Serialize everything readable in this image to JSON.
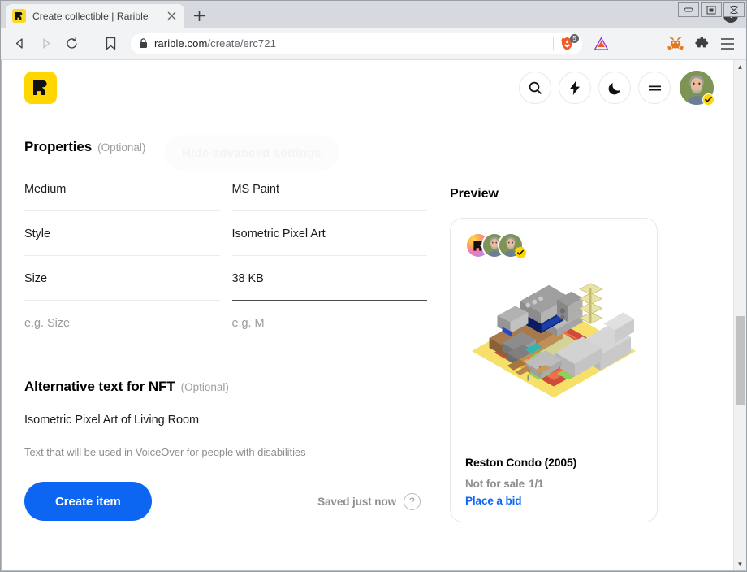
{
  "browser": {
    "window_controls": {
      "minimize": "minimize-icon",
      "maximize": "maximize-icon",
      "close": "close-icon"
    },
    "tab": {
      "title": "Create collectible | Rarible",
      "favicon": "rarible-logo-icon",
      "close_label": "×"
    },
    "new_tab_label": "+",
    "tab_search_icon": "chevron-down-icon",
    "toolbar": {
      "back_icon": "back-arrow-icon",
      "forward_icon": "forward-arrow-icon",
      "reload_icon": "reload-icon",
      "bookmark_icon": "bookmark-icon",
      "lock_icon": "lock-icon",
      "url_domain": "rarible.com",
      "url_path": "/create/erc721",
      "brave_shield_icon": "brave-lion-icon",
      "brave_badge_count": "5",
      "bat_icon": "bat-triangle-icon",
      "metamask_icon": "metamask-fox-icon",
      "extensions_icon": "puzzle-piece-icon",
      "menu_icon": "hamburger-menu-icon"
    }
  },
  "page": {
    "logo": "rarible-logo-icon",
    "ghost_button_label": "Hide advanced settings",
    "header_buttons": [
      {
        "name": "search-button",
        "icon": "search-icon"
      },
      {
        "name": "activity-button",
        "icon": "lightning-bolt-icon"
      },
      {
        "name": "dark-mode-button",
        "icon": "moon-icon"
      },
      {
        "name": "menu-button",
        "icon": "equals-menu-icon"
      }
    ],
    "avatar": {
      "name": "user-avatar",
      "verified": true
    },
    "properties": {
      "heading": "Properties",
      "optional": "(Optional)",
      "rows": [
        {
          "key": "Medium",
          "value": "MS Paint",
          "key_placeholder": false,
          "value_placeholder": false,
          "value_active": false
        },
        {
          "key": "Style",
          "value": "Isometric Pixel Art",
          "key_placeholder": false,
          "value_placeholder": false,
          "value_active": false
        },
        {
          "key": "Size",
          "value": "38 KB",
          "key_placeholder": false,
          "value_placeholder": false,
          "value_active": true
        },
        {
          "key": "e.g. Size",
          "value": "e.g. M",
          "key_placeholder": true,
          "value_placeholder": true,
          "value_active": false
        }
      ]
    },
    "alt_text": {
      "heading": "Alternative text for NFT",
      "optional": "(Optional)",
      "value": "Isometric Pixel Art of Living Room",
      "help": "Text that will be used in VoiceOver for people with disabilities"
    },
    "actions": {
      "create_label": "Create item",
      "saved_label": "Saved just now",
      "help_label": "?"
    },
    "preview": {
      "heading": "Preview",
      "avatars": [
        "rarible-gradient-avatar",
        "creator-avatar",
        "owner-avatar"
      ],
      "nft_title": "Reston Condo (2005)",
      "price_status": "Not for sale",
      "edition": "1/1",
      "bid_label": "Place a bid",
      "artwork_alt": "Isometric pixel art living room with CRT television, entertainment center, grey sectional sofa and patterned red rug"
    }
  },
  "colors": {
    "accent_blue": "#0d66f2",
    "rarible_yellow": "#ffd600",
    "text_primary": "#000000",
    "text_muted": "#8e8e8e",
    "border": "#e8e8e8"
  },
  "scrollbar": {
    "up_arrow": "▲",
    "down_arrow": "▼"
  }
}
